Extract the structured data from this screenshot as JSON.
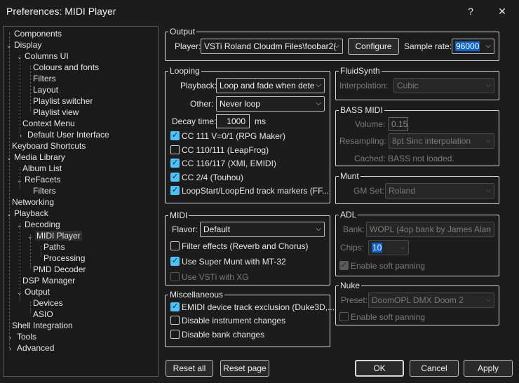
{
  "window": {
    "title": "Preferences: MIDI Player",
    "help": "?",
    "close": "✕"
  },
  "tree": [
    {
      "label": "Components",
      "expander": ""
    },
    {
      "label": "Display",
      "expander": "⌄"
    },
    {
      "label": "Columns UI",
      "expander": "⌄"
    },
    {
      "label": "Colours and fonts",
      "expander": ""
    },
    {
      "label": "Filters",
      "expander": ""
    },
    {
      "label": "Layout",
      "expander": ""
    },
    {
      "label": "Playlist switcher",
      "expander": ""
    },
    {
      "label": "Playlist view",
      "expander": ""
    },
    {
      "label": "Context Menu",
      "expander": ""
    },
    {
      "label": "Default User Interface",
      "expander": "›"
    },
    {
      "label": "Keyboard Shortcuts",
      "expander": ""
    },
    {
      "label": "Media Library",
      "expander": "⌄"
    },
    {
      "label": "Album List",
      "expander": ""
    },
    {
      "label": "ReFacets",
      "expander": "⌄"
    },
    {
      "label": "Filters",
      "expander": ""
    },
    {
      "label": "Networking",
      "expander": ""
    },
    {
      "label": "Playback",
      "expander": "⌄"
    },
    {
      "label": "Decoding",
      "expander": "⌄"
    },
    {
      "label": "MIDI Player",
      "expander": "⌄"
    },
    {
      "label": "Paths",
      "expander": ""
    },
    {
      "label": "Processing",
      "expander": ""
    },
    {
      "label": "PMD Decoder",
      "expander": ""
    },
    {
      "label": "DSP Manager",
      "expander": ""
    },
    {
      "label": "Output",
      "expander": "⌄"
    },
    {
      "label": "Devices",
      "expander": ""
    },
    {
      "label": "ASIO",
      "expander": ""
    },
    {
      "label": "Shell Integration",
      "expander": ""
    },
    {
      "label": "Tools",
      "expander": "›"
    },
    {
      "label": "Advanced",
      "expander": "›"
    }
  ],
  "output": {
    "title": "Output",
    "player_label": "Player:",
    "player_value": "VSTi Roland Cloudm Files\\foobar2(",
    "configure": "Configure",
    "sample_rate_label": "Sample rate:",
    "sample_rate_value": "96000"
  },
  "looping": {
    "title": "Looping",
    "playback_label": "Playback:",
    "playback_value": "Loop and fade when dete",
    "other_label": "Other:",
    "other_value": "Never loop",
    "decay_label": "Decay time:",
    "decay_value": "1000",
    "decay_unit": "ms",
    "options": [
      {
        "label": "CC 111 V=0/1 (RPG Maker)",
        "checked": true
      },
      {
        "label": "CC 110/111 (LeapFrog)",
        "checked": false
      },
      {
        "label": "CC 116/117 (XMI, EMIDI)",
        "checked": true
      },
      {
        "label": "CC 2/4 (Touhou)",
        "checked": true
      },
      {
        "label": "LoopStart/LoopEnd track markers (FF...",
        "checked": true
      }
    ]
  },
  "midi": {
    "title": "MIDI",
    "flavor_label": "Flavor:",
    "flavor_value": "Default",
    "options": [
      {
        "label": "Filter effects (Reverb and Chorus)",
        "checked": false,
        "disabled": false
      },
      {
        "label": "Use Super Munt with MT-32",
        "checked": true,
        "disabled": false
      },
      {
        "label": "Use VSTi with XG",
        "checked": false,
        "disabled": true
      }
    ]
  },
  "misc": {
    "title": "Miscellaneous",
    "options": [
      {
        "label": "EMIDI device track exclusion (Duke3D,...",
        "checked": true
      },
      {
        "label": "Disable instrument changes",
        "checked": false
      },
      {
        "label": "Disable bank changes",
        "checked": false
      }
    ]
  },
  "fluidsynth": {
    "title": "FluidSynth",
    "interpolation_label": "Interpolation:",
    "interpolation_value": "Cubic"
  },
  "bassmidi": {
    "title": "BASS MIDI",
    "volume_label": "Volume:",
    "volume_value": "0.15",
    "resampling_label": "Resampling:",
    "resampling_value": "8pt Sinc interpolation",
    "cached_label": "Cached:",
    "cached_value": "BASS not loaded."
  },
  "munt": {
    "title": "Munt",
    "gmset_label": "GM Set:",
    "gmset_value": "Roland"
  },
  "adl": {
    "title": "ADL",
    "bank_label": "Bank:",
    "bank_value": "WOPL (4op bank by James Alan",
    "chips_label": "Chips:",
    "chips_value": "10",
    "soft_panning": "Enable soft panning"
  },
  "nuke": {
    "title": "Nuke",
    "preset_label": "Preset:",
    "preset_value": "DoomOPL DMX Doom 2",
    "soft_panning": "Enable soft panning"
  },
  "buttons": {
    "reset_all": "Reset all",
    "reset_page": "Reset page",
    "ok": "OK",
    "cancel": "Cancel",
    "apply": "Apply"
  }
}
